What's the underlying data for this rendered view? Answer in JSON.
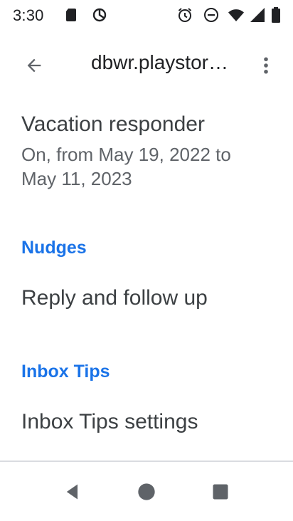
{
  "status_bar": {
    "time": "3:30"
  },
  "app_bar": {
    "title": "dbwr.playstore@gmail.com"
  },
  "settings": {
    "vacation_responder": {
      "title": "Vacation responder",
      "subtitle": "On, from May 19, 2022 to May 11, 2023"
    },
    "nudges_header": "Nudges",
    "reply_follow_up": {
      "title": "Reply and follow up"
    },
    "inbox_tips_header": "Inbox Tips",
    "inbox_tips_settings": {
      "title": "Inbox Tips settings"
    }
  },
  "icons": {
    "sd_card": "sd-card-icon",
    "sync": "sync-icon",
    "alarm": "alarm-icon",
    "dnd": "do-not-disturb-icon",
    "wifi": "wifi-icon",
    "signal": "signal-icon",
    "battery": "battery-icon",
    "back": "arrow-back-icon",
    "more": "more-vert-icon",
    "nav_back": "nav-back-icon",
    "nav_home": "nav-home-icon",
    "nav_recents": "nav-recents-icon"
  },
  "colors": {
    "accent": "#1a73e8",
    "text_primary": "#3c4043",
    "text_secondary": "#5f6368",
    "icon": "#5f6368"
  }
}
